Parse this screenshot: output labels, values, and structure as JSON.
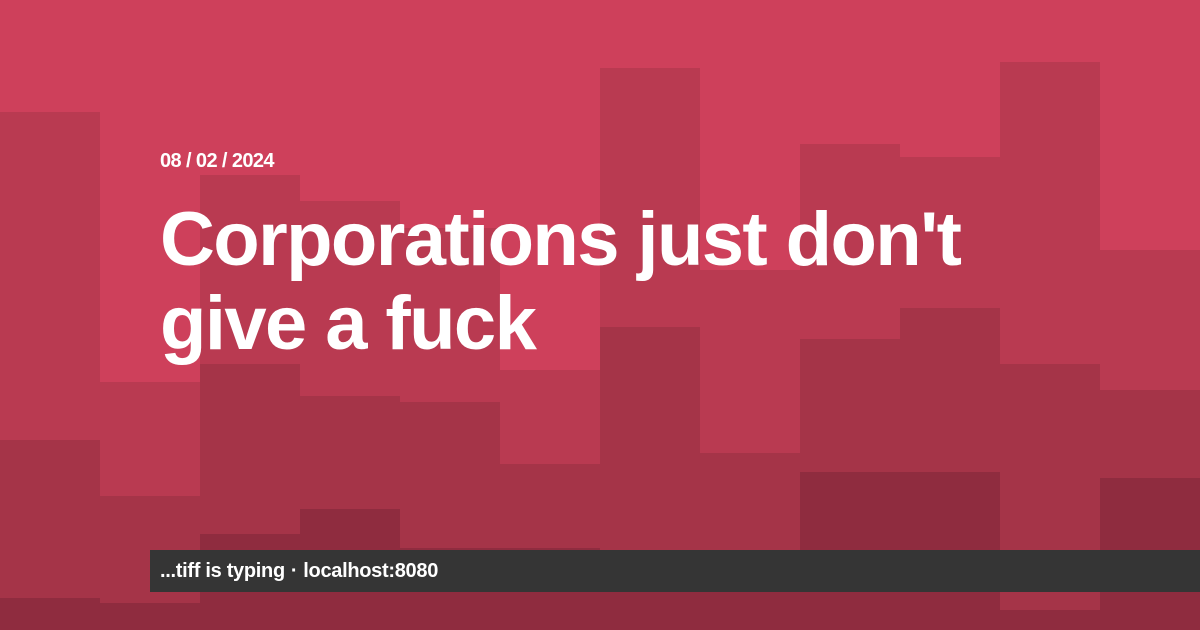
{
  "post": {
    "date": "08 / 02 / 2024",
    "title": "Corporations just don't give a fuck"
  },
  "footer": {
    "author_text": "...tiff is typing",
    "separator": "·",
    "site": "localhost:8080"
  },
  "colors": {
    "background": "#ce405b",
    "footer_bar": "#353535",
    "text": "#ffffff"
  }
}
